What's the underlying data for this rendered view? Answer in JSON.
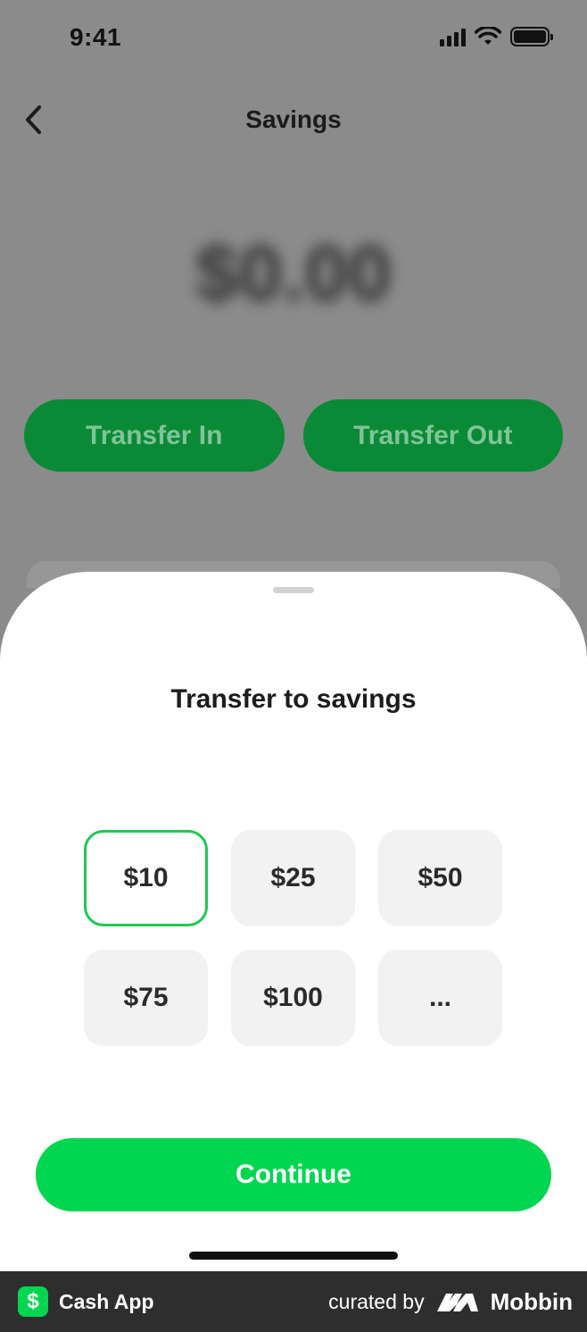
{
  "status_bar": {
    "time": "9:41"
  },
  "nav": {
    "title": "Savings"
  },
  "balance": {
    "amount": "$0.00"
  },
  "actions": {
    "transfer_in": "Transfer In",
    "transfer_out": "Transfer Out"
  },
  "sheet": {
    "title": "Transfer to savings",
    "amounts": [
      {
        "label": "$10",
        "selected": true
      },
      {
        "label": "$25",
        "selected": false
      },
      {
        "label": "$50",
        "selected": false
      },
      {
        "label": "$75",
        "selected": false
      },
      {
        "label": "$100",
        "selected": false
      },
      {
        "label": "...",
        "selected": false
      }
    ],
    "continue_label": "Continue"
  },
  "footer": {
    "app_name": "Cash App",
    "curated_by": "curated by",
    "brand": "Mobbin"
  },
  "colors": {
    "accent_green": "#00d64f",
    "dimmed_green": "#0a8a36",
    "selected_border": "#1ec954"
  },
  "icons": [
    "back-chevron-icon",
    "signal-icon",
    "wifi-icon",
    "battery-icon",
    "cashapp-logo-icon",
    "mobbin-logo-icon"
  ]
}
